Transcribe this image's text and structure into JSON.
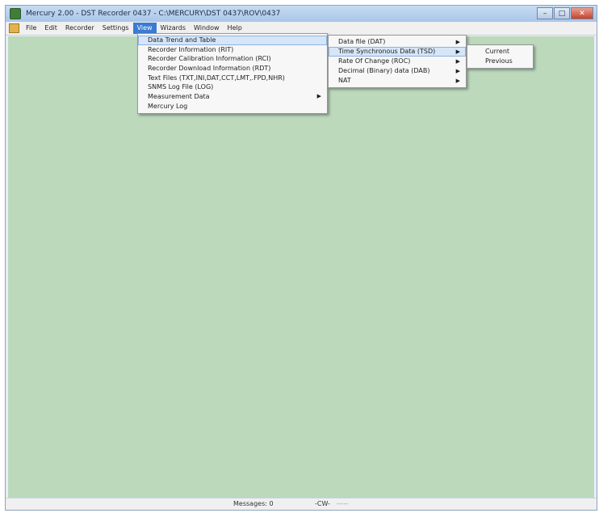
{
  "window": {
    "title": "Mercury 2.00 - DST Recorder 0437 - C:\\MERCURY\\DST 0437\\ROV\\0437",
    "controls": {
      "minimize": "–",
      "maximize": "□",
      "close": "✕"
    }
  },
  "menubar": {
    "items": [
      {
        "label": "File"
      },
      {
        "label": "Edit"
      },
      {
        "label": "Recorder"
      },
      {
        "label": "Settings"
      },
      {
        "label": "View"
      },
      {
        "label": "Wizards"
      },
      {
        "label": "Window"
      },
      {
        "label": "Help"
      }
    ],
    "active": "View"
  },
  "view_menu": {
    "items": [
      {
        "label": "Data Trend and Table"
      },
      {
        "label": "Recorder Information (RIT)"
      },
      {
        "label": "Recorder Calibration Information (RCI)"
      },
      {
        "label": "Recorder Download Information (RDT)"
      },
      {
        "label": "Text Files (TXT,INI,DAT,CCT,LMT,.FPD,NHR)"
      },
      {
        "label": "SNMS Log File (LOG)"
      },
      {
        "label": "Measurement Data"
      },
      {
        "label": "Mercury Log"
      }
    ]
  },
  "data_submenu": {
    "items": [
      {
        "label": "Data file (DAT)"
      },
      {
        "label": "Time Synchronous Data (TSD)"
      },
      {
        "label": "Rate Of Change (ROC)"
      },
      {
        "label": "Decimal (Binary) data (DAB)"
      },
      {
        "label": "NAT"
      }
    ]
  },
  "tsd_submenu": {
    "items": [
      {
        "label": "Current"
      },
      {
        "label": "Previous"
      }
    ]
  },
  "statusbar": {
    "message": "Messages: 0",
    "value": "-CW-",
    "dash": "-----"
  },
  "colors": {
    "client_background": "#bcd9bc",
    "menu_highlight": "#3b7bd2",
    "submenu_highlight": "#d6e6f8"
  }
}
